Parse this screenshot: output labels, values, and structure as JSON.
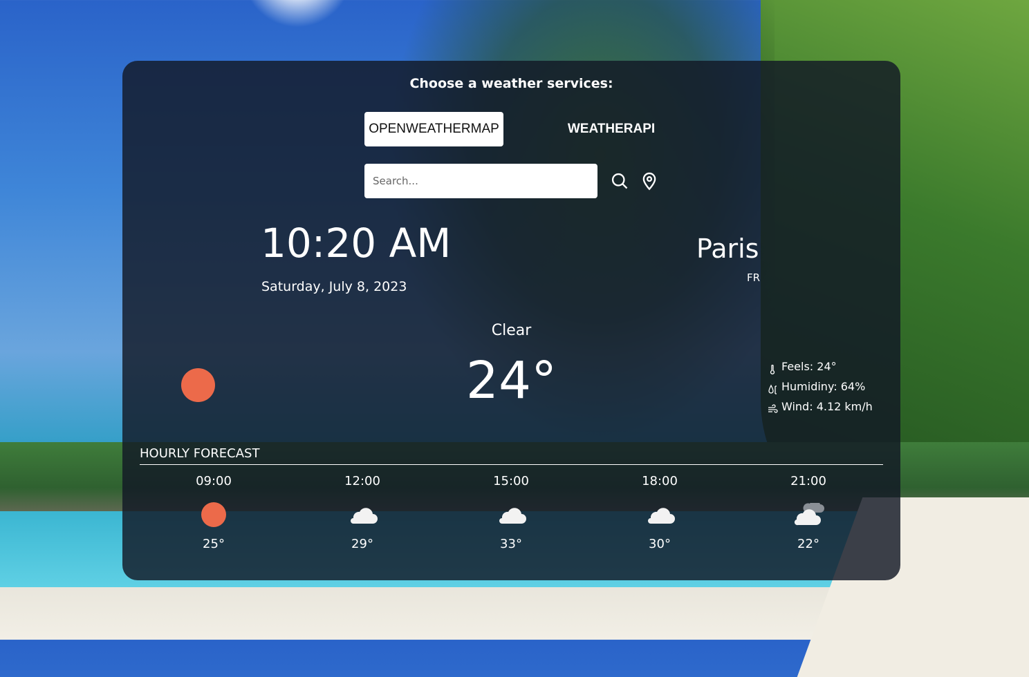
{
  "services": {
    "title": "Choose a weather services:",
    "options": [
      {
        "label": "OPENWEATHERMAP",
        "active": true
      },
      {
        "label": "WEATHERAPI",
        "active": false
      }
    ]
  },
  "search": {
    "placeholder": "Search...",
    "search_icon": "search-icon",
    "location_icon": "location-pin-icon"
  },
  "current": {
    "time": "10:20 AM",
    "date": "Saturday, July 8, 2023",
    "city": "Paris",
    "country": "FR",
    "condition": "Clear",
    "temperature": "24°",
    "icon": "sun-icon",
    "details": {
      "feels": "Feels: 24°",
      "humidity": "Humidiny: 64%",
      "wind": "Wind: 4.12 km/h"
    }
  },
  "hourly": {
    "title": "HOURLY FORECAST",
    "items": [
      {
        "time": "09:00",
        "temp": "25°",
        "icon": "sun-icon"
      },
      {
        "time": "12:00",
        "temp": "29°",
        "icon": "cloud-icon"
      },
      {
        "time": "15:00",
        "temp": "33°",
        "icon": "cloud-icon"
      },
      {
        "time": "18:00",
        "temp": "30°",
        "icon": "cloud-icon"
      },
      {
        "time": "21:00",
        "temp": "22°",
        "icon": "clouds-icon"
      }
    ]
  },
  "colors": {
    "sun": "#ec6a4a",
    "panel": "#121826"
  }
}
